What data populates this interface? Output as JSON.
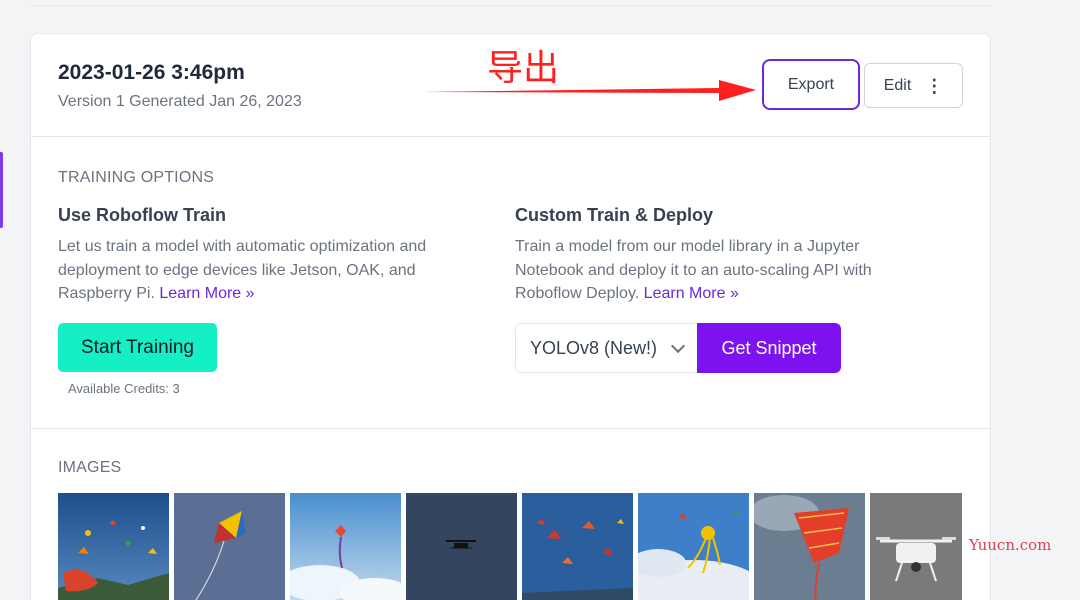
{
  "version": {
    "title": "2023-01-26 3:46pm",
    "subtitle": "Version 1 Generated Jan 26, 2023",
    "export_label": "Export",
    "edit_label": "Edit",
    "edit_menu_icon": "⋮"
  },
  "annotation": {
    "label": "导出",
    "arrow_color": "#ff1f1f"
  },
  "training": {
    "section_label": "TRAINING OPTIONS",
    "roboflow": {
      "title": "Use Roboflow Train",
      "description": "Let us train a model with automatic optimization and deployment to edge devices like Jetson, OAK, and Raspberry Pi.",
      "learn_more": "Learn More »",
      "button": "Start Training",
      "credits": "Available Credits: 3"
    },
    "custom": {
      "title": "Custom Train & Deploy",
      "description": "Train a model from our model library in a Jupyter Notebook and deploy it to an auto-scaling API with Roboflow Deploy.",
      "learn_more": "Learn More »",
      "model_selected": "YOLOv8 (New!)",
      "snippet_button": "Get Snippet"
    }
  },
  "images": {
    "section_label": "IMAGES",
    "thumbnails": [
      {
        "name": "kites-over-beach"
      },
      {
        "name": "single-kite-sky"
      },
      {
        "name": "kite-cloudy-sky"
      },
      {
        "name": "drone-dark-sky"
      },
      {
        "name": "many-kites-blue-sky"
      },
      {
        "name": "octopus-kite-clouds"
      },
      {
        "name": "red-kite-closeup"
      },
      {
        "name": "white-drone-gray"
      }
    ]
  },
  "watermark": "Yuucn.com",
  "colors": {
    "accent": "#7c12ef",
    "train_button": "#14f0c4",
    "link": "#6d28d9"
  }
}
